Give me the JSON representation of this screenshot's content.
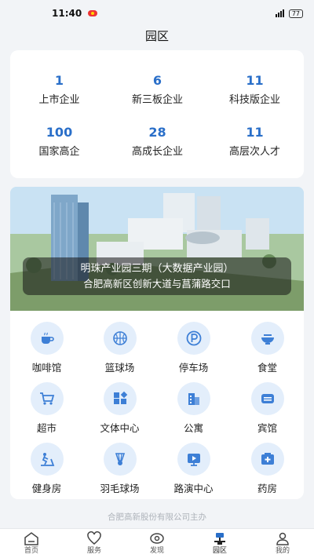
{
  "status_bar": {
    "time": "11:40",
    "battery": "77"
  },
  "header": {
    "title": "园区"
  },
  "stats": [
    {
      "value": "1",
      "label": "上市企业"
    },
    {
      "value": "6",
      "label": "新三板企业"
    },
    {
      "value": "11",
      "label": "科技版企业"
    },
    {
      "value": "100",
      "label": "国家高企"
    },
    {
      "value": "28",
      "label": "高成长企业"
    },
    {
      "value": "11",
      "label": "高层次人才"
    }
  ],
  "banner": {
    "title": "明珠产业园三期（大数据产业园）",
    "subtitle": "合肥高新区创新大道与菖蒲路交口"
  },
  "facilities": [
    {
      "label": "咖啡馆",
      "icon": "coffee-icon"
    },
    {
      "label": "篮球场",
      "icon": "basketball-icon"
    },
    {
      "label": "停车场",
      "icon": "parking-icon"
    },
    {
      "label": "食堂",
      "icon": "bowl-icon"
    },
    {
      "label": "超市",
      "icon": "cart-icon"
    },
    {
      "label": "文体中心",
      "icon": "blocks-icon"
    },
    {
      "label": "公寓",
      "icon": "building-icon"
    },
    {
      "label": "宾馆",
      "icon": "hotel-icon"
    },
    {
      "label": "健身房",
      "icon": "treadmill-icon"
    },
    {
      "label": "羽毛球场",
      "icon": "badminton-icon"
    },
    {
      "label": "路演中心",
      "icon": "roadshow-icon"
    },
    {
      "label": "药房",
      "icon": "pharmacy-icon"
    }
  ],
  "footer": {
    "note": "合肥高新股份有限公司主办"
  },
  "tabs": [
    {
      "label": "首页",
      "icon": "home-icon"
    },
    {
      "label": "服务",
      "icon": "heart-icon"
    },
    {
      "label": "发现",
      "icon": "eye-icon"
    },
    {
      "label": "园区",
      "icon": "park-icon",
      "active": true
    },
    {
      "label": "我的",
      "icon": "user-icon"
    }
  ],
  "colors": {
    "accent": "#2a6fc9",
    "icon_bg": "#e3eefb",
    "icon_fg": "#3d7fd6"
  }
}
